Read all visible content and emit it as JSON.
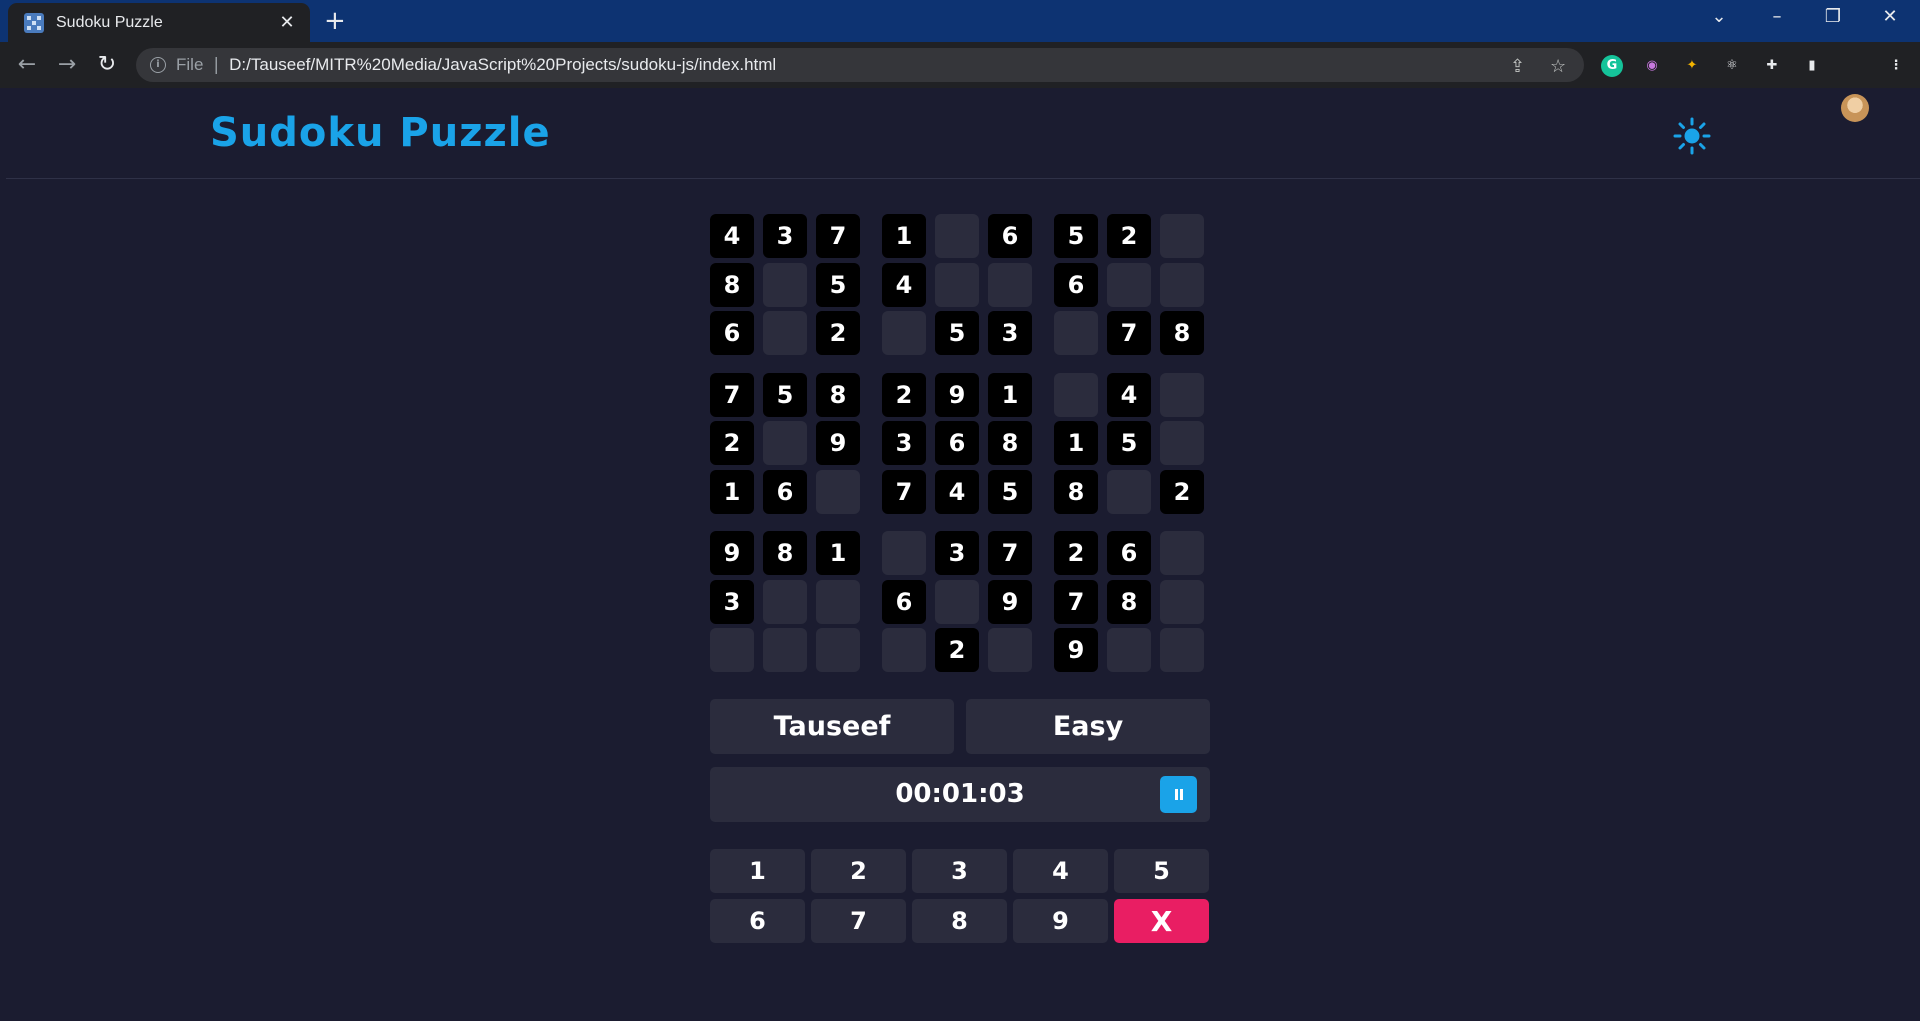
{
  "browser": {
    "tab_title": "Sudoku Puzzle",
    "address_prefix": "File",
    "url": "D:/Tauseef/MITR%20Media/JavaScript%20Projects/sudoku-js/index.html"
  },
  "page": {
    "title": "Sudoku Puzzle",
    "accent_color": "#1aa3e8"
  },
  "board": {
    "rows": [
      [
        "4",
        "3",
        "7",
        "1",
        "",
        "6",
        "5",
        "2",
        ""
      ],
      [
        "8",
        "",
        "5",
        "4",
        "",
        "",
        "6",
        "",
        ""
      ],
      [
        "6",
        "",
        "2",
        "",
        "5",
        "3",
        "",
        "7",
        "8"
      ],
      [
        "7",
        "5",
        "8",
        "2",
        "9",
        "1",
        "",
        "4",
        ""
      ],
      [
        "2",
        "",
        "9",
        "3",
        "6",
        "8",
        "1",
        "5",
        ""
      ],
      [
        "1",
        "6",
        "",
        "7",
        "4",
        "5",
        "8",
        "",
        "2"
      ],
      [
        "9",
        "8",
        "1",
        "",
        "3",
        "7",
        "2",
        "6",
        ""
      ],
      [
        "3",
        "",
        "",
        "6",
        "",
        "9",
        "7",
        "8",
        ""
      ],
      [
        "",
        "",
        "",
        "",
        "2",
        "",
        "9",
        "",
        ""
      ]
    ]
  },
  "game": {
    "player_name": "Tauseef",
    "difficulty": "Easy",
    "timer": "00:01:03"
  },
  "numpad": {
    "keys": [
      "1",
      "2",
      "3",
      "4",
      "5",
      "6",
      "7",
      "8",
      "9"
    ],
    "delete_label": "X",
    "delete_color": "#e91e63"
  }
}
